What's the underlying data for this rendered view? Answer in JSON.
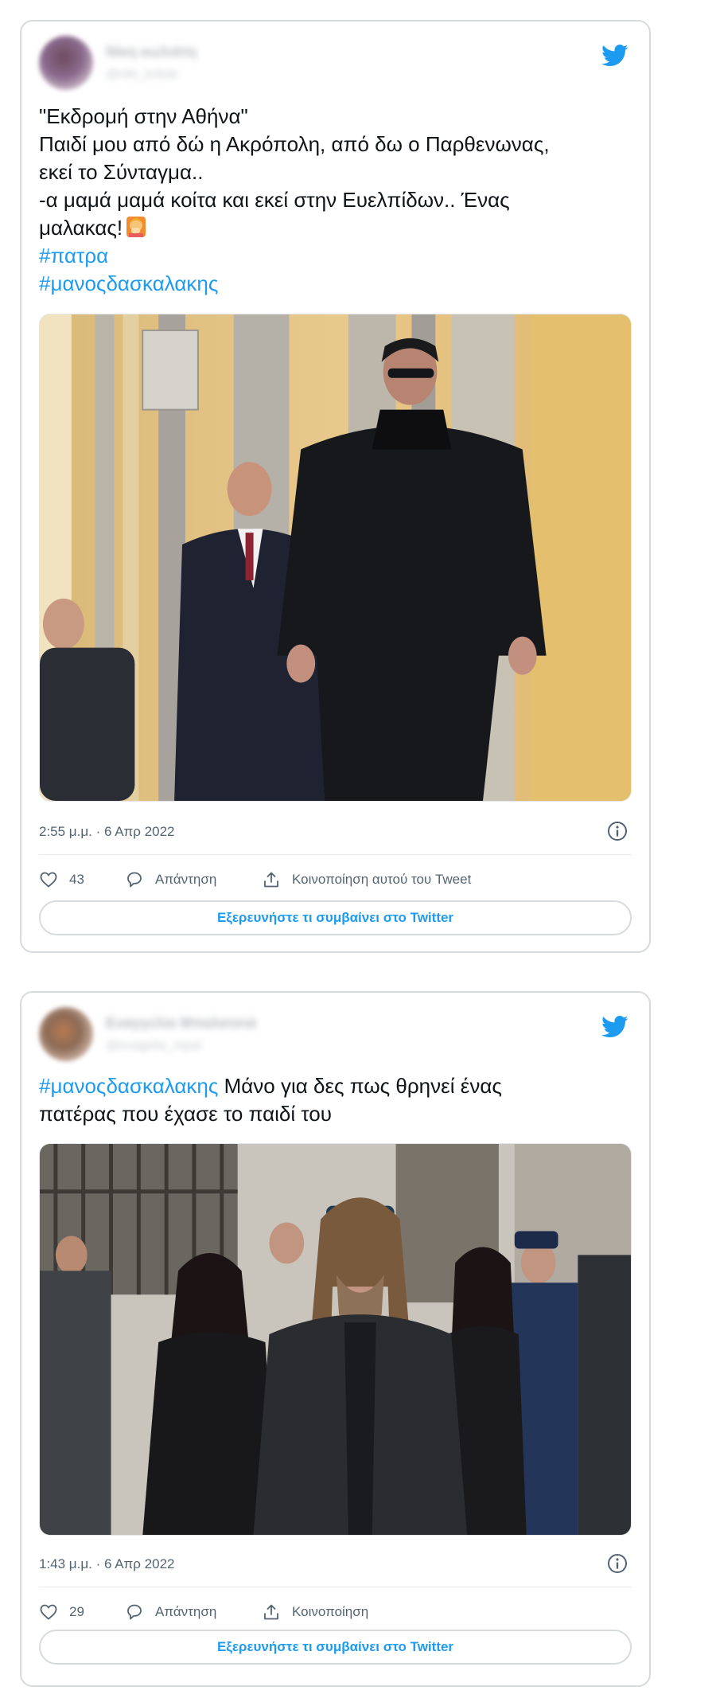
{
  "brand": {
    "accent": "#1d9bf0",
    "text": "#0f1419",
    "muted": "#536471",
    "border": "#d7dbdf"
  },
  "tweets": [
    {
      "author": {
        "name": "Νίκη κωλιάτη",
        "handle": "@niki_koliati",
        "avatar": "blurred-profile-photo"
      },
      "text_lines": [
        "\"Εκδρομή στην Αθήνα\"",
        "Παιδί μου από δώ η Ακρόπολη, από δω ο Παρθενωνας,",
        "εκεί το Σύνταγμα..",
        "-α μαμά μαμά κοίτα και εκεί στην Ευελπίδων.. Ένας",
        "μαλακας!"
      ],
      "emoji": "facepalm-emoji",
      "hashtags": [
        "#πατρα",
        "#μανοςδασκαλακης"
      ],
      "media": {
        "description": "photo",
        "icon": "photo"
      },
      "timestamp": "2:55 μ.μ. · 6 Απρ 2022",
      "likes": "43",
      "reply_label": "Απάντηση",
      "share_label": "Κοινοποίηση αυτού του Tweet",
      "explore_label": "Εξερευνήστε τι συμβαίνει στο Twitter"
    },
    {
      "author": {
        "name": "Ευαγγελία Μπαλατσιά",
        "handle": "@evagelia_mpal",
        "avatar": "blurred-profile-photo"
      },
      "hashtag": "#μανοςδασκαλακης",
      "text_line_1": " Μάνο για δες πως θρηνεί ένας",
      "text_line_2": "πατέρας που έχασε το παιδί του",
      "media": {
        "description": "photo",
        "icon": "photo"
      },
      "timestamp": "1:43 μ.μ. · 6 Απρ 2022",
      "likes": "29",
      "reply_label": "Απάντηση",
      "share_label": "Κοινοποίηση",
      "explore_label": "Εξερευνήστε τι συμβαίνει στο Twitter"
    }
  ]
}
